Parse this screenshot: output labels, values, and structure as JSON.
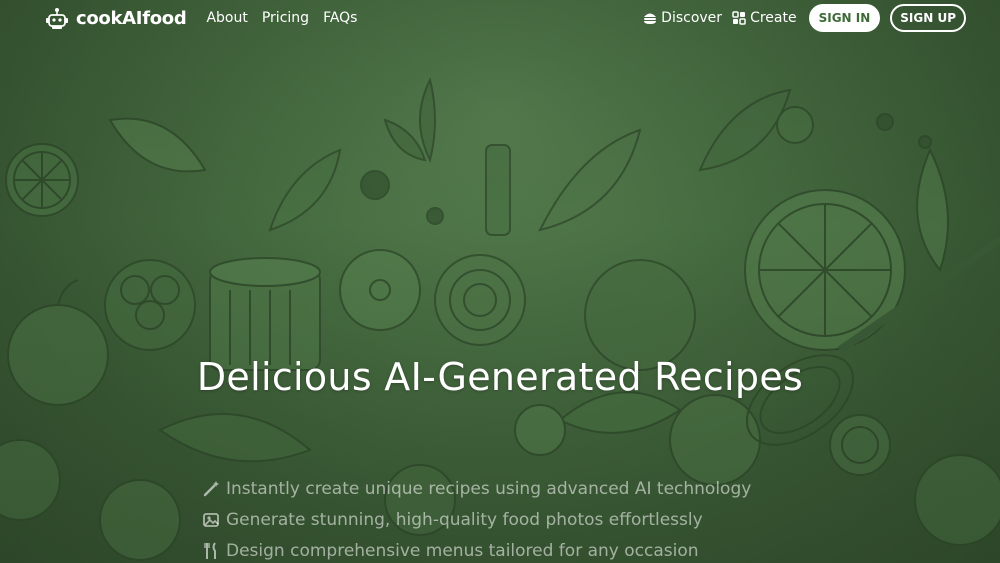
{
  "brand": {
    "name": "cookAIfood"
  },
  "nav": {
    "left": [
      {
        "label": "About"
      },
      {
        "label": "Pricing"
      },
      {
        "label": "FAQs"
      }
    ],
    "discover_label": "Discover",
    "create_label": "Create",
    "signin_label": "SIGN IN",
    "signup_label": "SIGN UP"
  },
  "hero": {
    "title": "Delicious AI-Generated Recipes",
    "features": [
      {
        "icon": "magic-wand-icon",
        "text": "Instantly create unique recipes using advanced AI technology"
      },
      {
        "icon": "image-icon",
        "text": "Generate stunning, high-quality food photos effortlessly"
      },
      {
        "icon": "utensils-icon",
        "text": "Design comprehensive menus tailored for any occasion"
      }
    ]
  },
  "colors": {
    "background": "#3f5c3a",
    "accent_green": "#3e6b37",
    "text": "#ffffff"
  }
}
